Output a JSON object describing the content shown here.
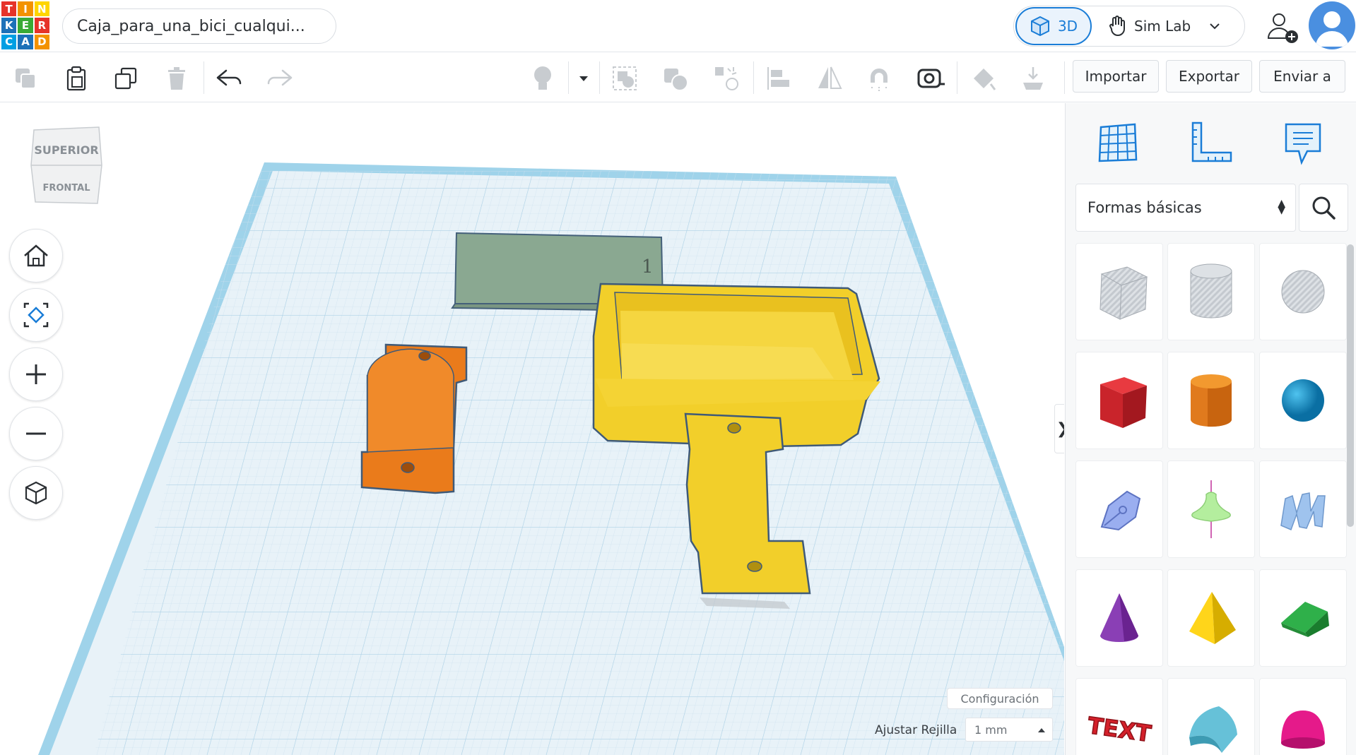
{
  "logo": {
    "letters": [
      "T",
      "I",
      "N",
      "K",
      "E",
      "R",
      "C",
      "A",
      "D"
    ]
  },
  "project": {
    "title": "Caja_para_una_bici_cualqui..."
  },
  "mode": {
    "view_3d_label": "3D",
    "simlab_label": "Sim Lab"
  },
  "toolbar": {
    "import_label": "Importar",
    "export_label": "Exportar",
    "send_label": "Enviar a"
  },
  "viewcube": {
    "top_label": "SUPERIOR",
    "front_label": "FRONTAL"
  },
  "workplane": {
    "config_label": "Configuración",
    "snap_grid_label": "Ajustar Rejilla",
    "snap_grid_value": "1 mm",
    "note_label": "1",
    "collapse_glyph": "❯"
  },
  "panel": {
    "category_value": "Formas básicas",
    "shapes": [
      {
        "name": "caja-hueco",
        "color": "#b8bdc3"
      },
      {
        "name": "cilindro-hueco",
        "color": "#b8bdc3"
      },
      {
        "name": "esfera-hueco",
        "color": "#b8bdc3"
      },
      {
        "name": "caja",
        "color": "#d4202a"
      },
      {
        "name": "cilindro",
        "color": "#e87722"
      },
      {
        "name": "esfera",
        "color": "#1a8fc8"
      },
      {
        "name": "garabato",
        "color": "#8aa0e0"
      },
      {
        "name": "grafico",
        "color": "#9ee08a"
      },
      {
        "name": "texto-3d-forma",
        "color": "#8fb8e8"
      },
      {
        "name": "cono",
        "color": "#7b2fa0"
      },
      {
        "name": "piramide",
        "color": "#f0c800"
      },
      {
        "name": "techo",
        "color": "#2aa53c"
      },
      {
        "name": "texto",
        "color": "#d4202a"
      },
      {
        "name": "medio-cilindro",
        "color": "#4fb0c8"
      },
      {
        "name": "paraboloide",
        "color": "#e0187a"
      }
    ],
    "text_shape_label": "TEXT"
  }
}
